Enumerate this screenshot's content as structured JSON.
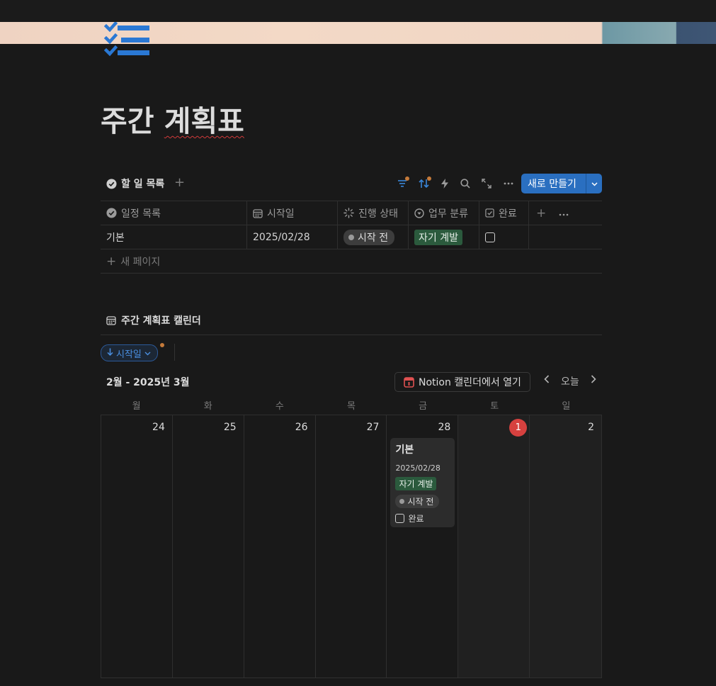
{
  "page": {
    "title_part1": "주간",
    "title_part2": "계획표",
    "icon": "checklist-icon"
  },
  "database": {
    "tab_label": "할 일 목록",
    "new_button_label": "새로 만들기",
    "columns": [
      "일정 목록",
      "시작일",
      "진행 상태",
      "업무 분류",
      "완료"
    ],
    "rows": [
      {
        "name": "기본",
        "start_date": "2025/02/28",
        "status": "시작 전",
        "category": "자기 계발",
        "done": false
      }
    ],
    "new_page_label": "새 페이지"
  },
  "calendar": {
    "title": "주간 계획표 캘린더",
    "sort_chip_label": "시작일",
    "month_label": "2월 - 2025년 3월",
    "open_in_calendar_label": "Notion 캘린더에서 열기",
    "today_label": "오늘",
    "weekdays": [
      "월",
      "화",
      "수",
      "목",
      "금",
      "토",
      "일"
    ],
    "days": [
      "24",
      "25",
      "26",
      "27",
      "28",
      "1",
      "2"
    ],
    "card": {
      "title": "기본",
      "date": "2025/02/28",
      "tag": "자기 계발",
      "status": "시작 전",
      "check_label": "완료"
    }
  },
  "colors": {
    "accent": "#2a6fc0",
    "today_red": "#d6413f",
    "tag_green": "#2b5a3d"
  }
}
